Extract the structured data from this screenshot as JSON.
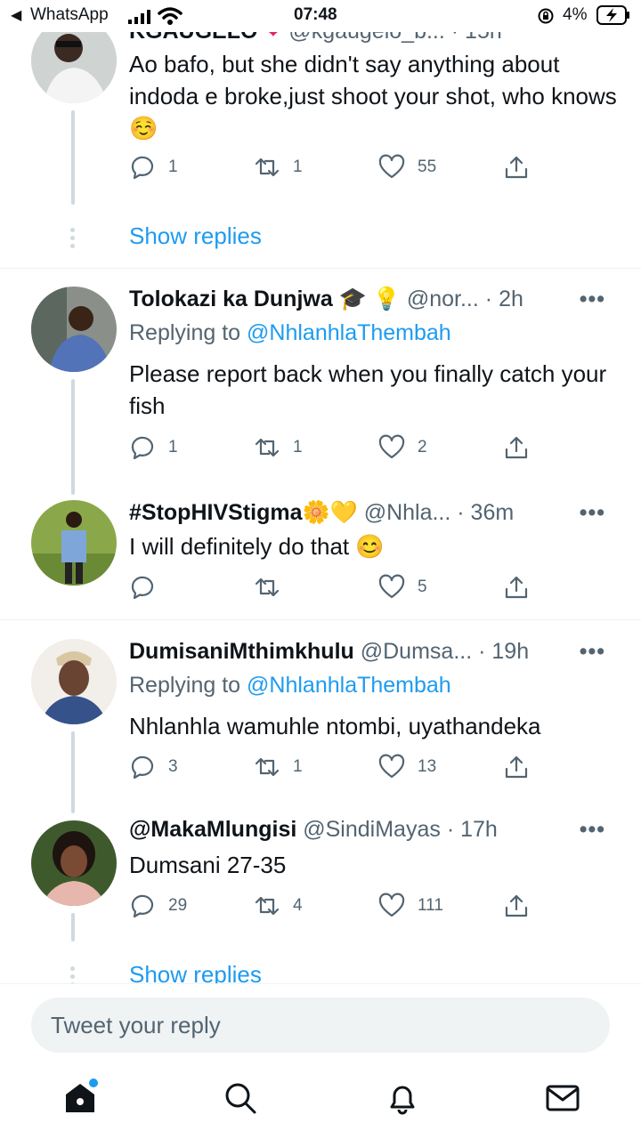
{
  "status_bar": {
    "back_app": "WhatsApp",
    "time": "07:48",
    "battery": "4%"
  },
  "tweets": [
    {
      "name": "KGAUGELO",
      "handle": "@kgaugelo_b...",
      "time": "· 15h",
      "body": "Ao bafo, but she didn't say anything about indoda e broke,just shoot your shot, who knows☺️",
      "replies": "1",
      "retweets": "1",
      "likes": "55"
    },
    {
      "name": "Tolokazi ka Dunjwa 🎓 💡",
      "handle": "@nor...",
      "time": "· 2h",
      "replying_prefix": "Replying to",
      "replying_to": "@NhlanhlaThembah",
      "body": "Please report back when you finally catch your fish",
      "replies": "1",
      "retweets": "1",
      "likes": "2"
    },
    {
      "name": "#StopHIVStigma🌼💛",
      "handle": "@Nhla...",
      "time": "· 36m",
      "body": "I will definitely do that 😊",
      "replies": "",
      "retweets": "",
      "likes": "5"
    },
    {
      "name": "DumisaniMthimkhulu",
      "handle": "@Dumsa...",
      "time": "· 19h",
      "replying_prefix": "Replying to",
      "replying_to": "@NhlanhlaThembah",
      "body": "Nhlanhla wamuhle ntombi, uyathandeka",
      "replies": "3",
      "retweets": "1",
      "likes": "13"
    },
    {
      "name": "@MakaMlungisi",
      "handle": "@SindiMayas",
      "time": "· 17h",
      "body": "Dumsani 27-35",
      "replies": "29",
      "retweets": "4",
      "likes": "111"
    }
  ],
  "show_replies": "Show replies",
  "composer": {
    "placeholder": "Tweet your reply"
  },
  "more_label": "•••",
  "nav": [
    "home-icon",
    "search-icon",
    "notifications-icon",
    "messages-icon"
  ],
  "colors": {
    "accent": "#1d9bf0",
    "muted": "#536471",
    "text": "#0f1419"
  }
}
